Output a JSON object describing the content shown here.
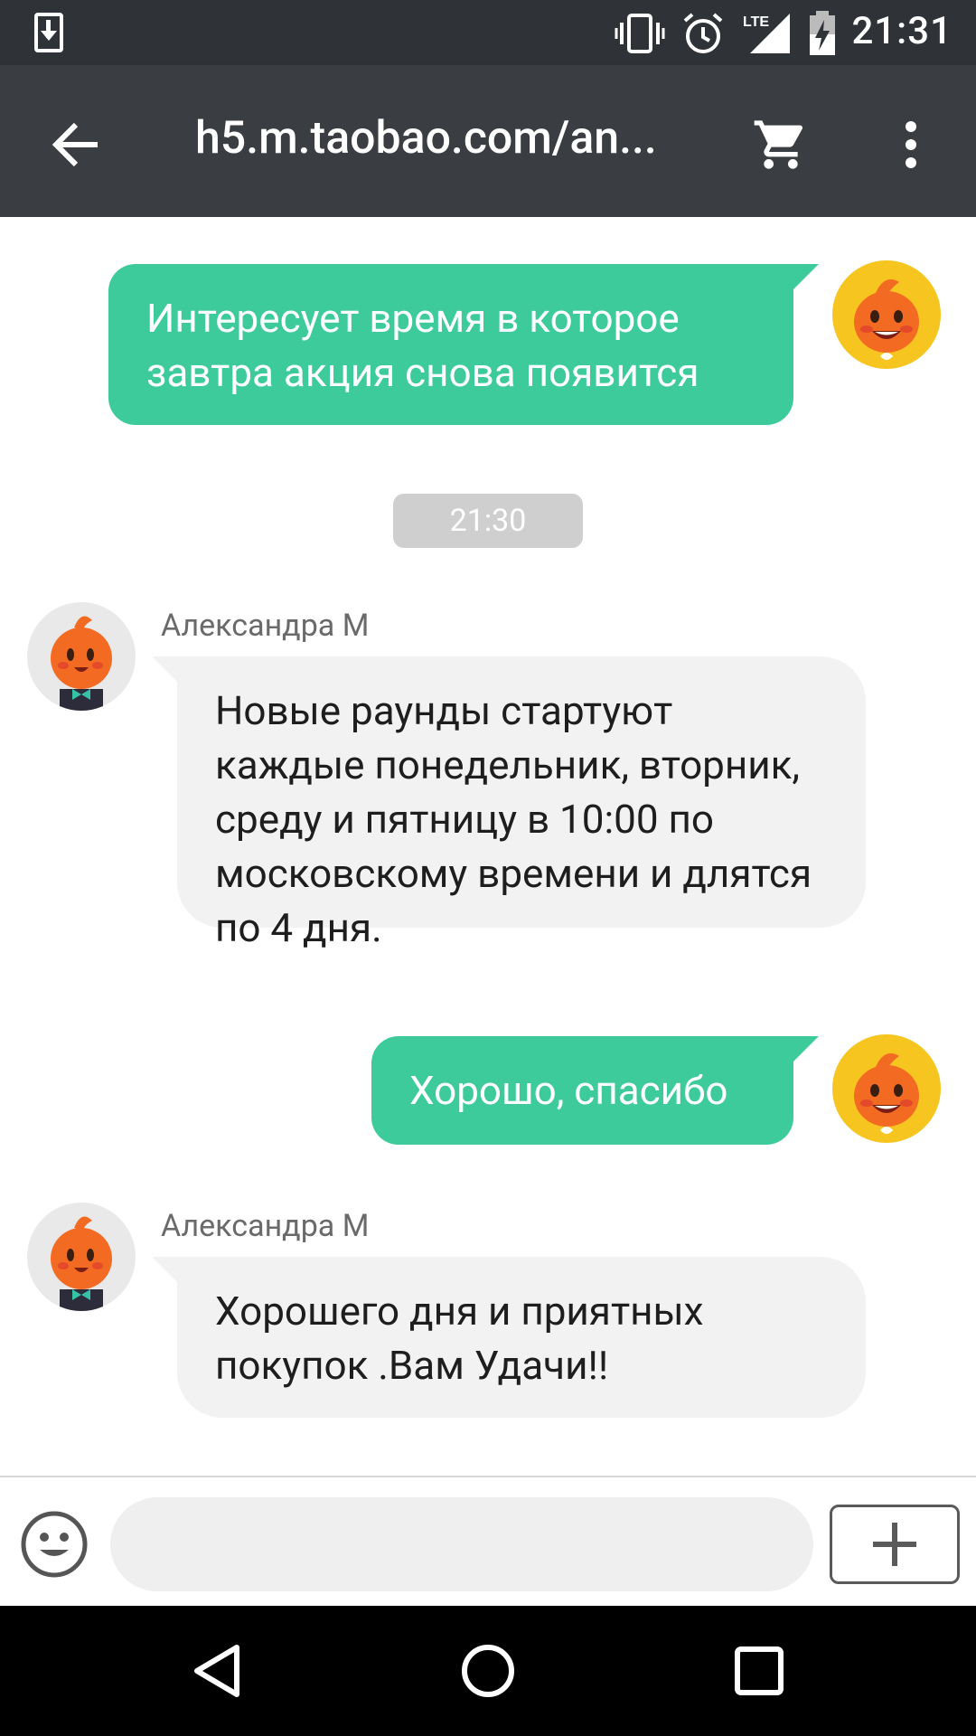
{
  "status_bar": {
    "time": "21:31",
    "network": "LTE"
  },
  "toolbar": {
    "url": "h5.m.taobao.com/an..."
  },
  "messages": [
    {
      "direction": "outgoing",
      "text": "Интересует время в которое завтра акция снова появится"
    },
    {
      "direction": "timestamp",
      "text": "21:30"
    },
    {
      "direction": "incoming",
      "sender": "Александра М",
      "text": "Новые раунды стартуют каждые понедельник, вторник, среду и пятницу в 10:00 по московскому времени и длятся по 4 дня."
    },
    {
      "direction": "outgoing",
      "text": "Хорошо, спасибо"
    },
    {
      "direction": "incoming",
      "sender": "Александра М",
      "text": "Хорошего дня и приятных покупок .Вам Удачи!!"
    }
  ],
  "input": {
    "placeholder": "",
    "value": ""
  },
  "colors": {
    "outgoing_bubble": "#3ecb9c",
    "incoming_bubble": "#f2f2f2",
    "toolbar": "#3a3e42",
    "status_bar": "#2f3337"
  }
}
